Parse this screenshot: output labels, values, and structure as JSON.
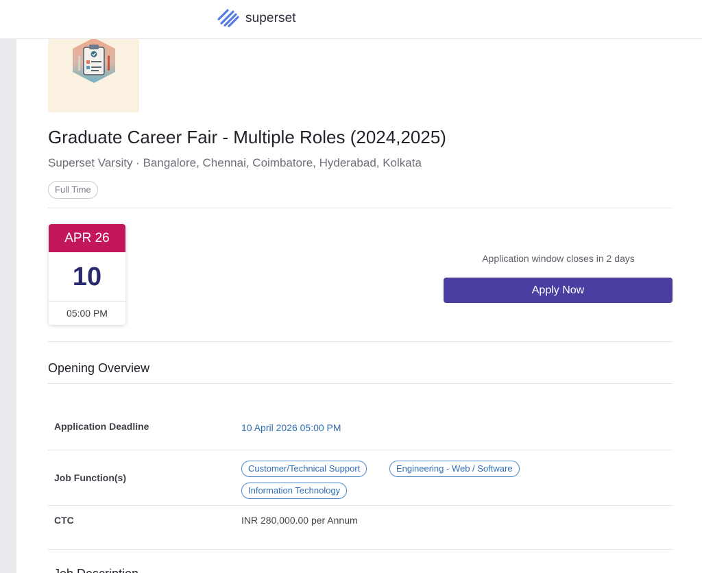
{
  "header": {
    "brand_name": "superset",
    "logo_icon": "superset-logo-icon"
  },
  "company_logo_icon": "clipboard-checklist-icon",
  "job": {
    "title": "Graduate Career Fair - Multiple Roles (2024,2025)",
    "subtitle": "Superset Varsity · Bangalore, Chennai, Coimbatore, Hyderabad, Kolkata",
    "type": "Full Time"
  },
  "deadline_calendar": {
    "month_year": "APR 26",
    "day": "10",
    "time": "05:00 PM"
  },
  "apply": {
    "window_text": "Application window closes in 2 days",
    "button_label": "Apply Now"
  },
  "overview": {
    "title": "Opening Overview",
    "rows": [
      {
        "label": "Application Deadline",
        "value": "10 April 2026 05:00 PM"
      },
      {
        "label": "Job Function(s)",
        "chips": [
          "Customer/Technical Support",
          "Engineering - Web / Software",
          "Information Technology"
        ]
      },
      {
        "label": "CTC",
        "value": "INR 280,000.00 per Annum"
      }
    ]
  },
  "next_section_title": "Job Description",
  "colors": {
    "accent": "#4a3fa0",
    "calendar_header": "#c2185b",
    "link": "#2f6db5",
    "calendar_day": "#2a2a6e"
  }
}
